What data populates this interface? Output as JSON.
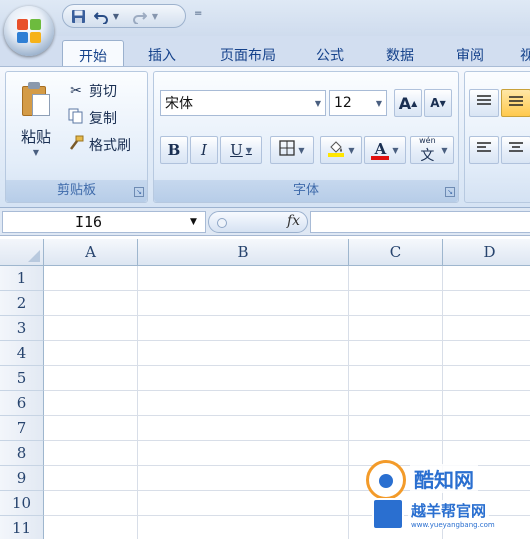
{
  "qat": {
    "save_icon": "save-icon",
    "undo_icon": "undo-icon",
    "redo_icon": "redo-icon",
    "customize": "="
  },
  "tabs": [
    "开始",
    "插入",
    "页面布局",
    "公式",
    "数据",
    "审阅",
    "视"
  ],
  "active_tab_index": 0,
  "clipboard": {
    "paste_label": "粘贴",
    "cut_label": "剪切",
    "copy_label": "复制",
    "format_painter_label": "格式刷",
    "group_label": "剪贴板"
  },
  "font": {
    "font_name": "宋体",
    "font_size": "12",
    "grow_label": "A",
    "shrink_label": "A",
    "bold_label": "B",
    "italic_label": "I",
    "underline_label": "U",
    "phonetic_top": "wén",
    "phonetic_main": "文",
    "font_color_label": "A",
    "group_label": "字体"
  },
  "formula_bar": {
    "name_box": "I16",
    "fx_label": "fx",
    "formula": ""
  },
  "grid": {
    "columns": [
      "A",
      "B",
      "C",
      "D"
    ],
    "rows": [
      "1",
      "2",
      "3",
      "4",
      "5",
      "6",
      "7",
      "8",
      "9",
      "10",
      "11"
    ]
  },
  "watermark": {
    "brand": "酷知网",
    "sub": "越羊帮官网",
    "url": "www.yueyangbang.com"
  },
  "colors": {
    "ribbon_blue": "#15428b",
    "font_color_bar": "#e01010",
    "fill_color_bar": "#ffe600"
  }
}
